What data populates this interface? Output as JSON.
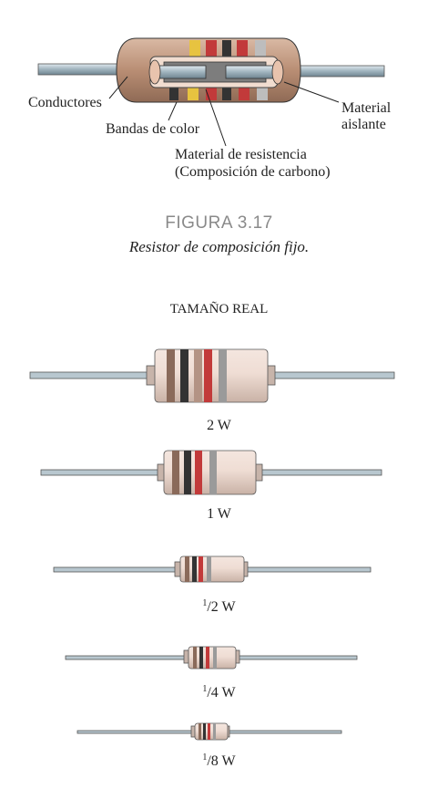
{
  "diagram": {
    "labels": {
      "conductores": "Conductores",
      "bandas": "Bandas de color",
      "material_aislante_1": "Material",
      "material_aislante_2": "aislante",
      "resistencia_1": "Material de resistencia",
      "resistencia_2": "(Composición de carbono)"
    }
  },
  "figure": {
    "number": "FIGURA 3.17",
    "caption": "Resistor de composición fijo."
  },
  "sizes": {
    "heading": "TAMAÑO REAL",
    "items": [
      {
        "whole": "2",
        "unit": "W"
      },
      {
        "whole": "1",
        "unit": "W"
      },
      {
        "numerator": "1",
        "denominator": "/2",
        "unit": "W"
      },
      {
        "numerator": "1",
        "denominator": "/4",
        "unit": "W"
      },
      {
        "numerator": "1",
        "denominator": "/8",
        "unit": "W"
      }
    ]
  },
  "colors": {
    "body_brown": "#b08a70",
    "lead": "#9fb3bd",
    "band_red": "#c23a3a",
    "band_black": "#333333"
  }
}
